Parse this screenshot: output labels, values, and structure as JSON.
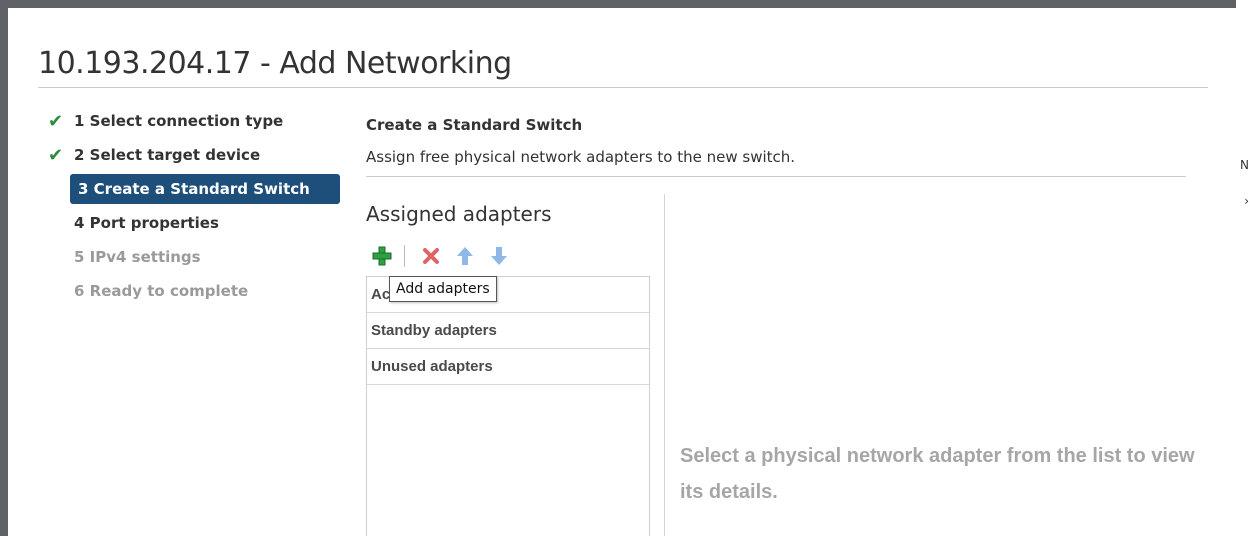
{
  "dialog": {
    "title": "10.193.204.17 - Add Networking"
  },
  "steps": [
    {
      "label": "1 Select connection type",
      "state": "done"
    },
    {
      "label": "2 Select target device",
      "state": "done"
    },
    {
      "label": "3 Create a Standard Switch",
      "state": "active"
    },
    {
      "label": "4 Port properties",
      "state": "pending"
    },
    {
      "label": "5 IPv4 settings",
      "state": "disabled"
    },
    {
      "label": "6 Ready to complete",
      "state": "disabled"
    }
  ],
  "section": {
    "title": "Create a Standard Switch",
    "description": "Assign free physical network adapters to the new switch."
  },
  "assigned": {
    "heading": "Assigned adapters",
    "toolbar": {
      "add_icon": "plus-icon",
      "remove_icon": "x-icon",
      "up_icon": "arrow-up-icon",
      "down_icon": "arrow-down-icon"
    },
    "rows": [
      {
        "label": "Active adapters"
      },
      {
        "label": "Standby adapters"
      },
      {
        "label": "Unused adapters"
      }
    ]
  },
  "tooltip": {
    "text": "Add adapters"
  },
  "details": {
    "message": "Select a physical network adapter from the list to view its details."
  },
  "colors": {
    "active_step_bg": "#1d4f7a",
    "check": "#2e8b3e",
    "add_icon": "#2ea043",
    "remove_icon": "#e06464",
    "arrow_icon": "#8fb8e8",
    "placeholder_text": "#a6a6a6"
  }
}
